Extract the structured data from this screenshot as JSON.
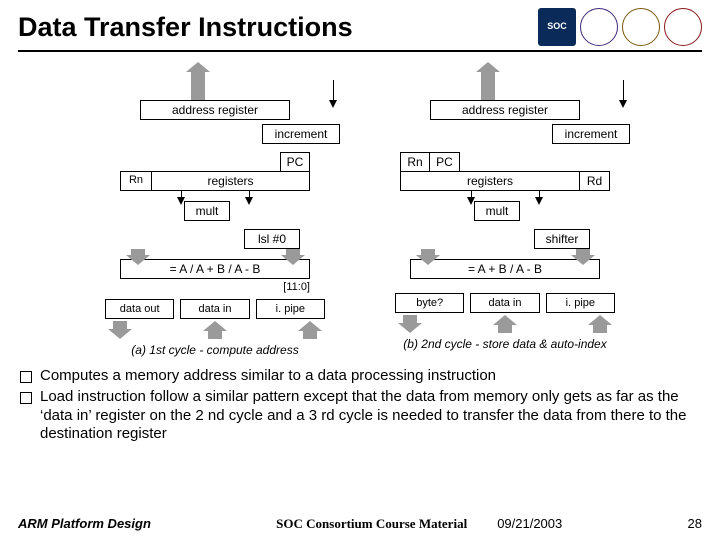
{
  "title": "Data Transfer Instructions",
  "logos": {
    "soc": "SOC",
    "l2": "",
    "l3": "",
    "l4": ""
  },
  "diagA": {
    "addr_reg": "address register",
    "increment": "increment",
    "pc": "PC",
    "rn": "Rn",
    "registers": "registers",
    "mult": "mult",
    "lsl": "lsl #0",
    "alu": "= A / A + B / A - B",
    "imm": "[11:0]",
    "out": "data out",
    "in": "data in",
    "pipe": "i. pipe",
    "caption": "(a) 1st cycle - compute address"
  },
  "diagB": {
    "addr_reg": "address register",
    "increment": "increment",
    "rn": "Rn",
    "pc": "PC",
    "registers": "registers",
    "rd": "Rd",
    "mult": "mult",
    "shifter": "shifter",
    "alu": "= A + B / A - B",
    "byte": "byte?",
    "in": "data in",
    "pipe": "i. pipe",
    "caption": "(b) 2nd cycle - store data & auto-index"
  },
  "bullets": [
    "Computes a memory address similar to a data processing instruction",
    "Load instruction follow a similar pattern except that the data from memory only gets as far as the ‘data in’ register on the 2 nd cycle and a 3 rd cycle is needed to transfer the data from there to the destination register"
  ],
  "footer": {
    "left": "ARM Platform Design",
    "center": "SOC Consortium Course Material",
    "date": "09/21/2003",
    "page": "28"
  }
}
